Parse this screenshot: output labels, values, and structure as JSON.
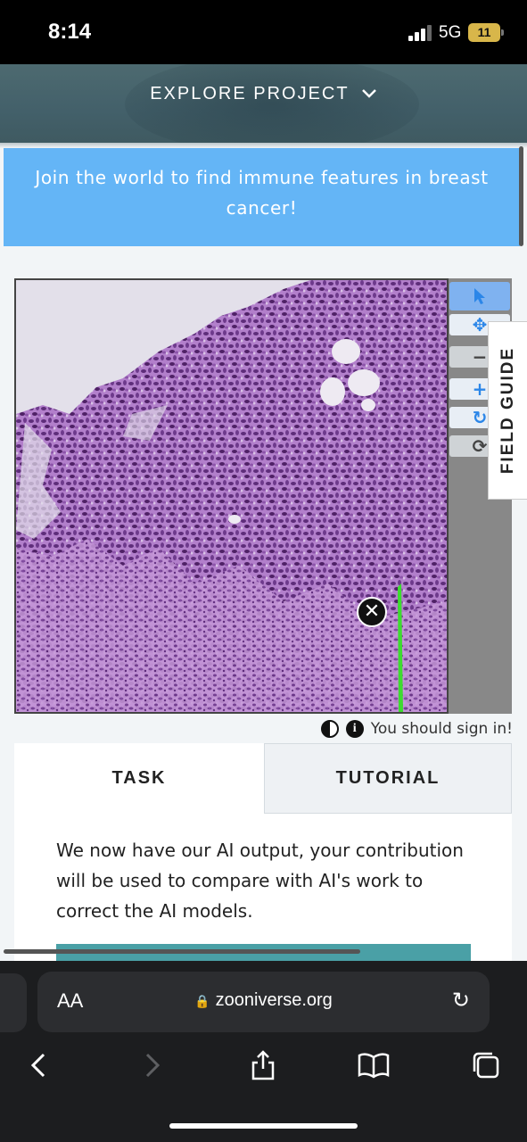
{
  "status_bar": {
    "time": "8:14",
    "network": "5G",
    "battery": "11"
  },
  "header": {
    "explore_label": "EXPLORE PROJECT"
  },
  "banner": {
    "text": "Join the world to find immune features in breast cancer!"
  },
  "viewer": {
    "tools": [
      "pointer-icon",
      "move-icon",
      "zoom-out-icon",
      "zoom-in-icon",
      "rotate-icon",
      "reset-icon"
    ],
    "field_guide_label": "FIELD GUIDE",
    "stain_color": "#9b5fb4",
    "marker_color": "#3ddc2f"
  },
  "signin": {
    "text": "You should sign in!"
  },
  "tabs": {
    "task": "TASK",
    "tutorial": "TUTORIAL"
  },
  "task": {
    "text": "We now have our AI output, your contribution will be used to compare with AI's work to correct the AI models."
  },
  "browser": {
    "text_size_label": "AA",
    "url": "zooniverse.org"
  },
  "colors": {
    "banner": "#64b5f6",
    "header": "#4d6a70",
    "teal": "#4aa0a6"
  }
}
